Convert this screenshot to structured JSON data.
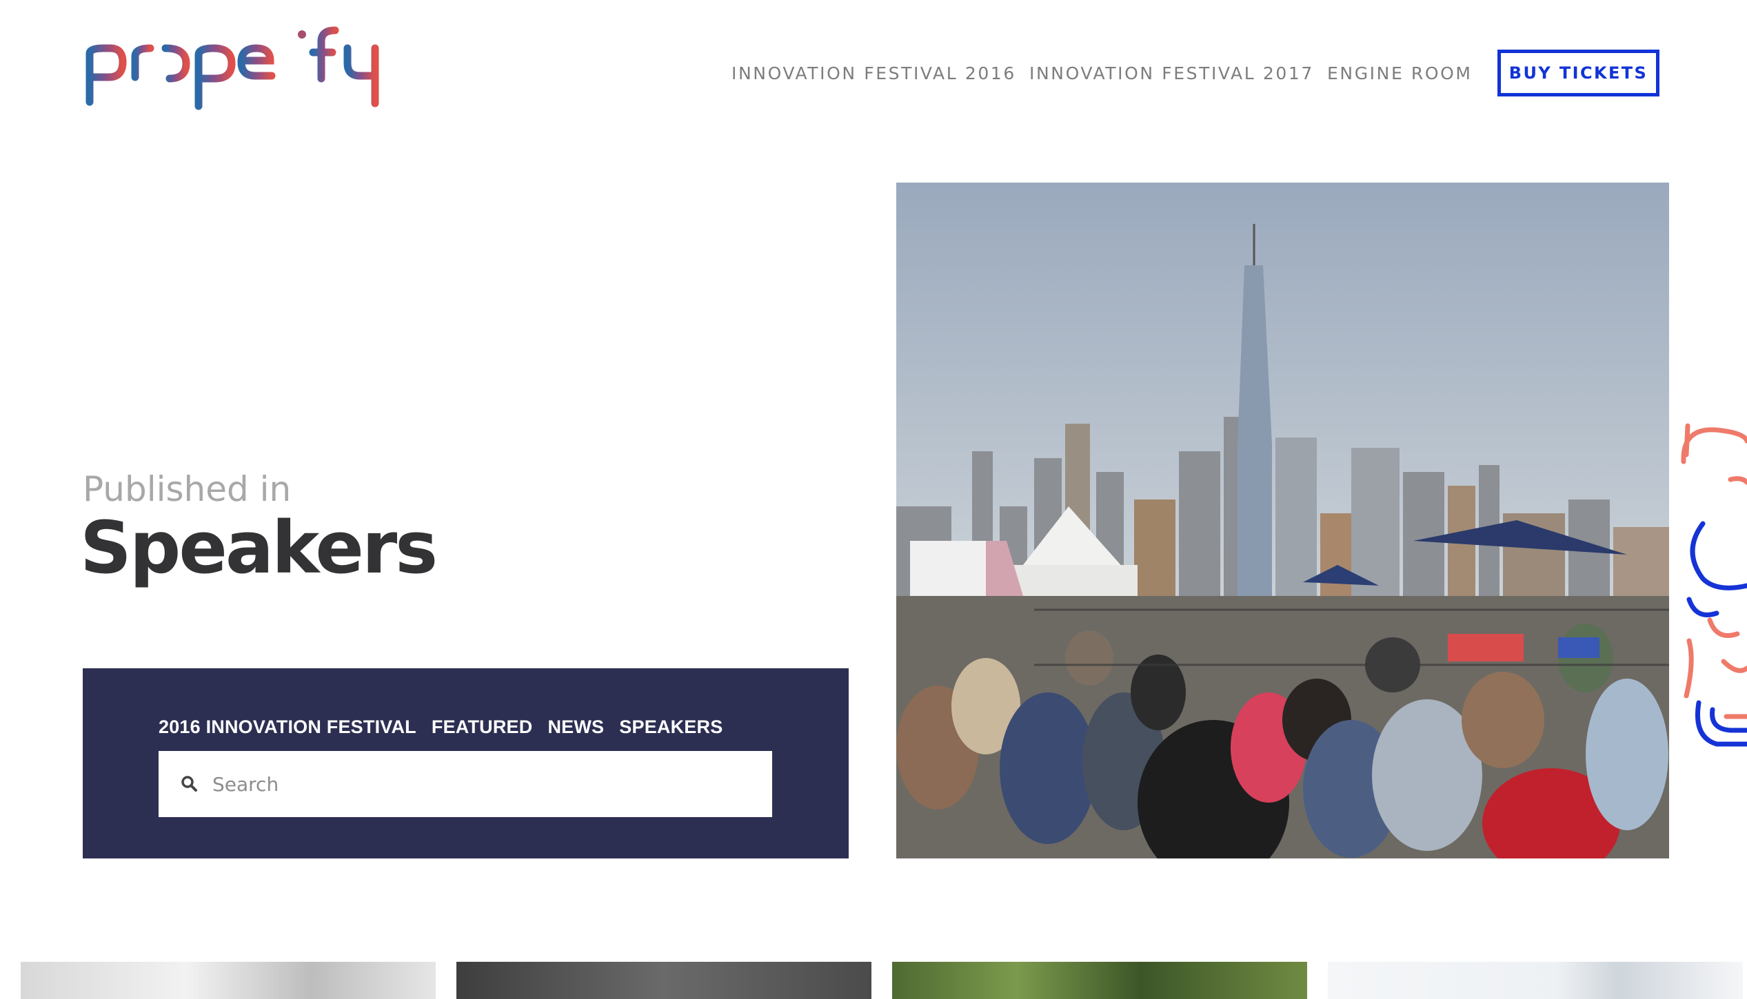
{
  "brand": {
    "logo_text": "propelify",
    "colors": {
      "blue": "#2a6aa8",
      "purple": "#8a4f86",
      "red": "#e0504a"
    }
  },
  "nav": {
    "links": [
      {
        "label": "INNOVATION FESTIVAL 2016"
      },
      {
        "label": "INNOVATION FESTIVAL 2017"
      },
      {
        "label": "ENGINE ROOM"
      }
    ],
    "cta_label": "BUY TICKETS",
    "cta_color": "#1133d6"
  },
  "hero": {
    "published_label": "Published in",
    "category_title": "Speakers",
    "image_icon": "festival-crowd-skyline-photo"
  },
  "filter_panel": {
    "background": "#2d2f52",
    "links": [
      {
        "label": "2016 INNOVATION FESTIVAL"
      },
      {
        "label": "FEATURED"
      },
      {
        "label": "NEWS"
      },
      {
        "label": "SPEAKERS"
      }
    ],
    "search": {
      "placeholder": "Search",
      "value": ""
    }
  },
  "thumbnails": [
    {
      "icon": "article-photo-grayscale"
    },
    {
      "icon": "article-photo-dark-stage"
    },
    {
      "icon": "article-photo-trees"
    },
    {
      "icon": "article-photo-bright"
    }
  ]
}
